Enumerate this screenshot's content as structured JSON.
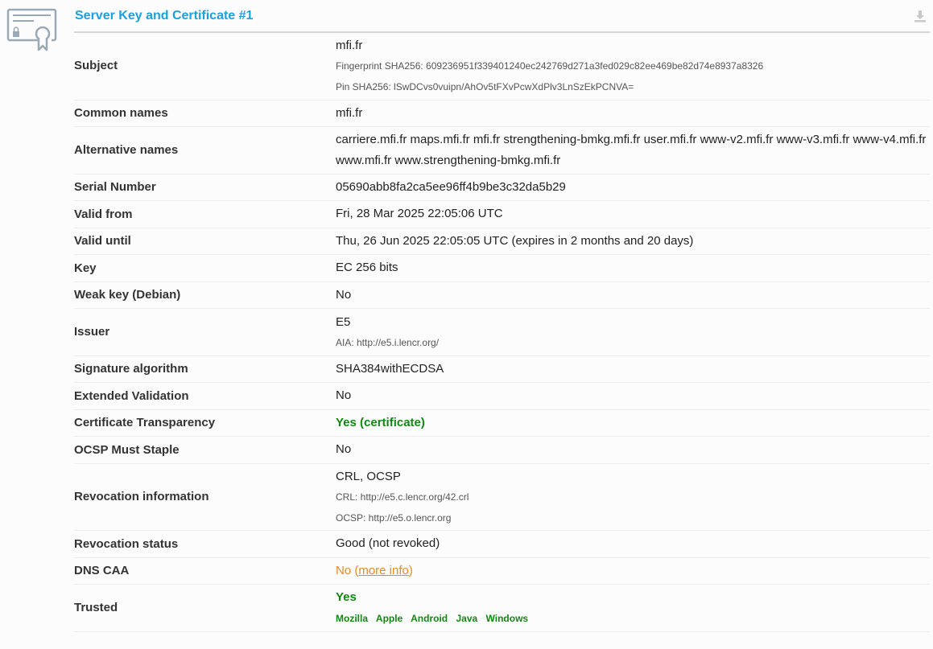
{
  "header": {
    "title": "Server Key and Certificate #1"
  },
  "rows": {
    "subject": {
      "label": "Subject",
      "value": "mfi.fr",
      "fingerprint": "Fingerprint SHA256: 609236951f339401240ec242769d271a3fed029c82ee469be82d74e8937a8326",
      "pin": "Pin SHA256: lSwDCvs0vuipn/AhOv5tFXvPcwXdPlv3LnSzEkPCNVA="
    },
    "common_names": {
      "label": "Common names",
      "value": "mfi.fr"
    },
    "alt_names": {
      "label": "Alternative names",
      "value": "carriere.mfi.fr maps.mfi.fr mfi.fr strengthening-bmkg.mfi.fr user.mfi.fr www-v2.mfi.fr www-v3.mfi.fr www-v4.mfi.fr www.mfi.fr www.strengthening-bmkg.mfi.fr"
    },
    "serial": {
      "label": "Serial Number",
      "value": "05690abb8fa2ca5ee96ff4b9be3c32da5b29"
    },
    "valid_from": {
      "label": "Valid from",
      "value": "Fri, 28 Mar 2025 22:05:06 UTC"
    },
    "valid_until": {
      "label": "Valid until",
      "value": "Thu, 26 Jun 2025 22:05:05 UTC (expires in 2 months and 20 days)"
    },
    "key": {
      "label": "Key",
      "value": "EC 256 bits"
    },
    "weak_key": {
      "label": "Weak key (Debian)",
      "value": "No"
    },
    "issuer": {
      "label": "Issuer",
      "value": "E5",
      "aia": "AIA: http://e5.i.lencr.org/"
    },
    "sig_alg": {
      "label": "Signature algorithm",
      "value": "SHA384withECDSA"
    },
    "ev": {
      "label": "Extended Validation",
      "value": "No"
    },
    "ct": {
      "label": "Certificate Transparency",
      "value": "Yes (certificate)"
    },
    "ocsp_staple": {
      "label": "OCSP Must Staple",
      "value": "No"
    },
    "revocation_info": {
      "label": "Revocation information",
      "value": "CRL, OCSP",
      "crl": "CRL: http://e5.c.lencr.org/42.crl",
      "ocsp": "OCSP: http://e5.o.lencr.org"
    },
    "revocation_status": {
      "label": "Revocation status",
      "value": "Good (not revoked)"
    },
    "dns_caa": {
      "label": "DNS CAA",
      "value_prefix": "No (",
      "link": "more info",
      "value_suffix": ")"
    },
    "trusted": {
      "label": "Trusted",
      "value": "Yes",
      "stores": [
        "Mozilla",
        "Apple",
        "Android",
        "Java",
        "Windows"
      ]
    }
  },
  "colors": {
    "accent": "#1aa1e0",
    "good": "#118811",
    "warning": "#e88a22",
    "icon": "#9aa9b6"
  }
}
